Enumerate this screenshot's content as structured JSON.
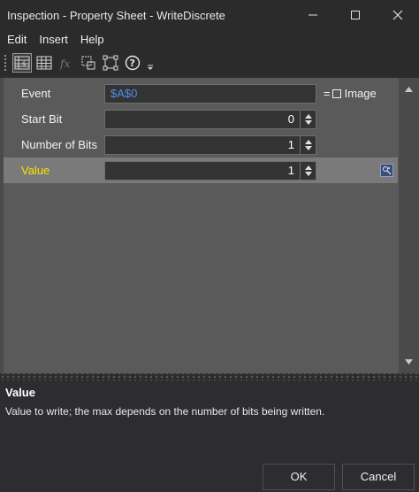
{
  "window": {
    "title": "Inspection - Property Sheet - WriteDiscrete"
  },
  "menu": {
    "items": [
      "Edit",
      "Insert",
      "Help"
    ]
  },
  "toolbar": {
    "icons": [
      "categorized-view-icon",
      "table-view-icon",
      "function-icon",
      "select-object-icon",
      "group-select-icon",
      "help-icon",
      "overflow-icon"
    ]
  },
  "properties": [
    {
      "label": "Event",
      "value": "$A$0",
      "type": "text",
      "extra": "Image"
    },
    {
      "label": "Start Bit",
      "value": "0",
      "type": "spinner"
    },
    {
      "label": "Number of Bits",
      "value": "1",
      "type": "spinner"
    },
    {
      "label": "Value",
      "value": "1",
      "type": "spinner",
      "selected": true
    }
  ],
  "description": {
    "title": "Value",
    "text": "Value to write; the max depends on the number of bits being written."
  },
  "buttons": {
    "ok": "OK",
    "cancel": "Cancel"
  },
  "colors": {
    "selected_label": "#f5e600",
    "event_value": "#4f8fe8",
    "grid_background": "#5a5a5a",
    "selected_row": "#7a7a7a"
  }
}
